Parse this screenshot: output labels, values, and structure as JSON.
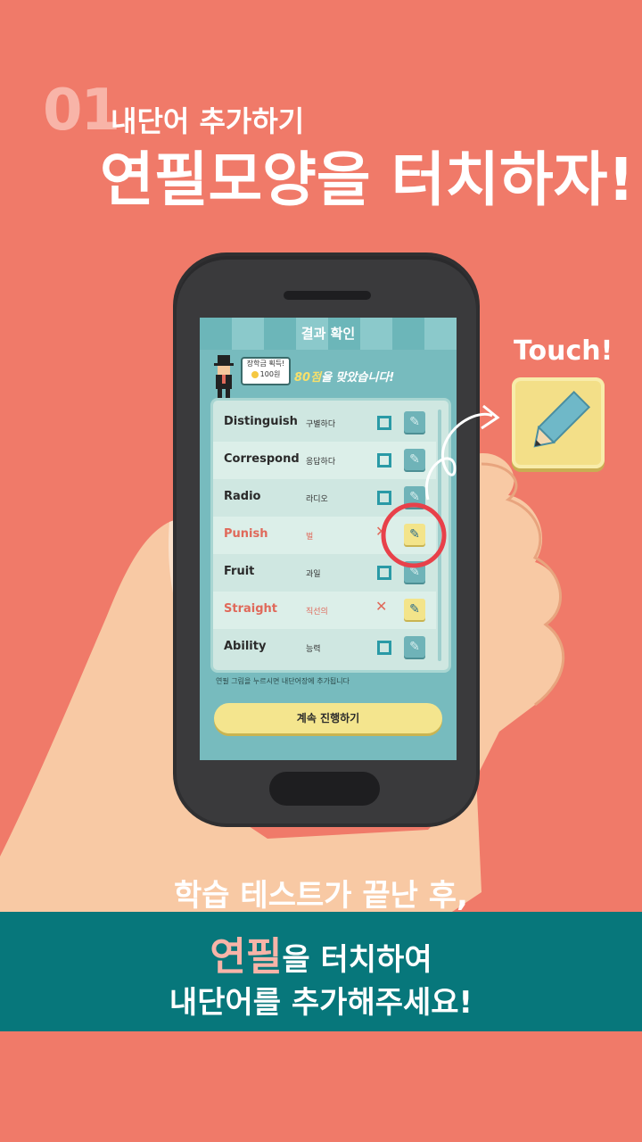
{
  "header": {
    "step_number": "01",
    "step_label": "내단어 추가하기",
    "headline": "연필모양을 터치하자!"
  },
  "app": {
    "title": "결과 확인",
    "coin_label": "장학금 획득!",
    "coin_amount": "100원",
    "score": "80점",
    "score_suffix": "을 맞았습니다!",
    "hint": "연필 그림을 누르시면 내단어장에 추가됩니다",
    "continue_label": "계속 진행하기",
    "words": [
      {
        "en": "Distinguish",
        "ko": "구별하다",
        "correct": true
      },
      {
        "en": "Correspond",
        "ko": "응답하다",
        "correct": true
      },
      {
        "en": "Radio",
        "ko": "라디오",
        "correct": true
      },
      {
        "en": "Punish",
        "ko": "벌",
        "correct": false
      },
      {
        "en": "Fruit",
        "ko": "과일",
        "correct": true
      },
      {
        "en": "Straight",
        "ko": "직선의",
        "correct": false
      },
      {
        "en": "Ability",
        "ko": "능력",
        "correct": true
      }
    ]
  },
  "callout": {
    "touch_label": "Touch!",
    "icon": "pencil-icon"
  },
  "footer": {
    "line0": "학습 테스트가 끝난 후,",
    "highlight": "연필",
    "line1_rest": "을 터치하여",
    "line2": "내단어를 추가해주세요!"
  },
  "colors": {
    "background": "#f07a69",
    "band": "#07777b",
    "highlight": "#f8b4a8",
    "wrong": "#e0695a",
    "correct": "#2a9aa6"
  }
}
